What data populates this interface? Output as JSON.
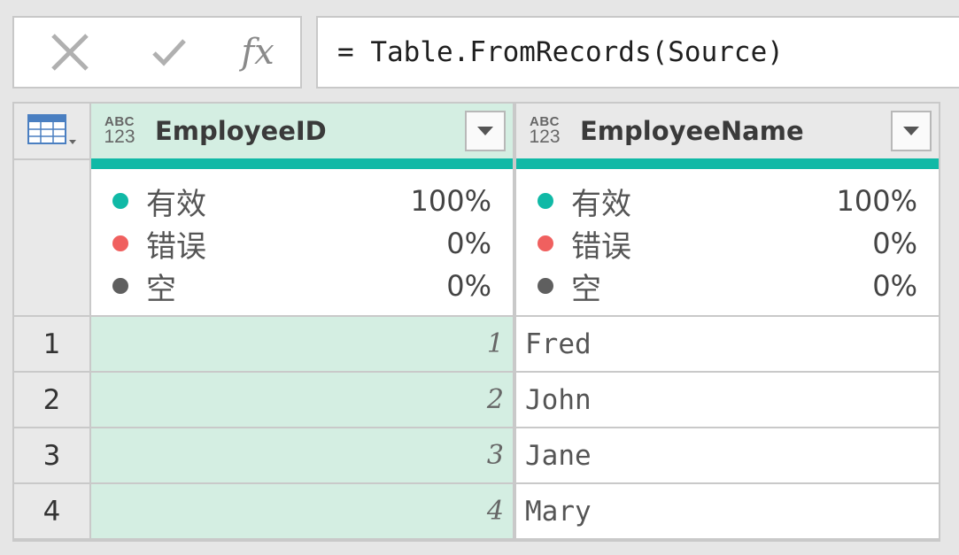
{
  "formula_bar": {
    "formula": "= Table.FromRecords(Source)",
    "insert_function_label": "fx",
    "icons": [
      "close-icon",
      "check-icon",
      "fx-icon"
    ]
  },
  "table": {
    "columns": [
      {
        "name": "EmployeeID",
        "type_top": "ABC",
        "type_bottom": "123",
        "selected": true
      },
      {
        "name": "EmployeeName",
        "type_top": "ABC",
        "type_bottom": "123",
        "selected": false
      }
    ],
    "quality": {
      "labels": {
        "valid": "有效",
        "error": "错误",
        "empty": "空"
      },
      "colors": {
        "valid": "#10b9a6",
        "error": "#f0605f",
        "empty": "#5f5f5f",
        "selected_column": "#d4eee2"
      },
      "values": [
        {
          "valid": "100%",
          "error": "0%",
          "empty": "0%"
        },
        {
          "valid": "100%",
          "error": "0%",
          "empty": "0%"
        }
      ]
    },
    "rows": [
      {
        "num": "1",
        "id": "1",
        "name": "Fred"
      },
      {
        "num": "2",
        "id": "2",
        "name": "John"
      },
      {
        "num": "3",
        "id": "3",
        "name": "Jane"
      },
      {
        "num": "4",
        "id": "4",
        "name": "Mary"
      }
    ]
  }
}
